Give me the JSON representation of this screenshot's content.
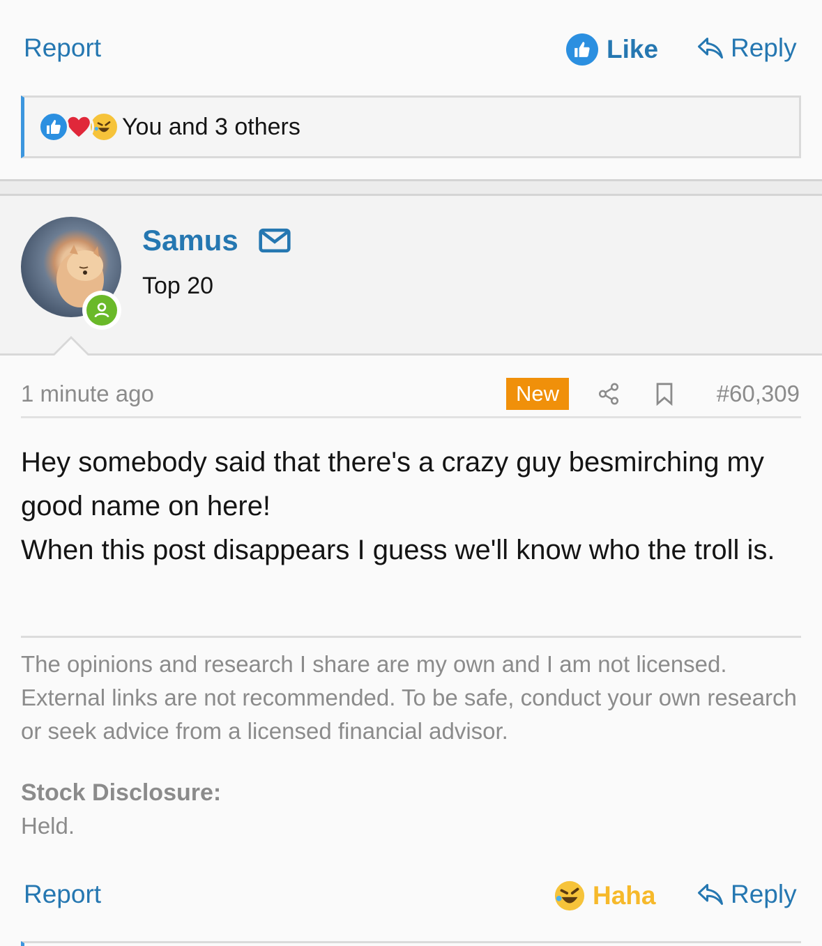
{
  "top_actions": {
    "report": "Report",
    "like": "Like",
    "reply": "Reply"
  },
  "reactions": {
    "icons": [
      "like-icon",
      "heart-icon",
      "haha-icon"
    ],
    "text": "You and 3 others"
  },
  "user": {
    "name": "Samus",
    "rank": "Top 20",
    "status": "online"
  },
  "meta": {
    "time": "1 minute ago",
    "badge": "New",
    "post_number": "#60,309"
  },
  "post": {
    "lines": [
      "Hey somebody said that there's a crazy guy besmirching my good name on here!",
      "When this post disappears I guess we'll know who the troll is."
    ]
  },
  "signature": {
    "text": "The opinions and research I share are my own and I am not licensed. External links are not recommended. To be safe, conduct your own research or seek advice from a licensed financial advisor.",
    "disclosure_label": "Stock Disclosure:",
    "disclosure_value": "Held."
  },
  "bottom_actions": {
    "report": "Report",
    "reaction": "Haha",
    "reply": "Reply"
  },
  "colors": {
    "link": "#2577b1",
    "new_badge": "#f0900a",
    "haha": "#f6b92b",
    "online": "#6ab929",
    "accent_bar": "#3c96de"
  }
}
